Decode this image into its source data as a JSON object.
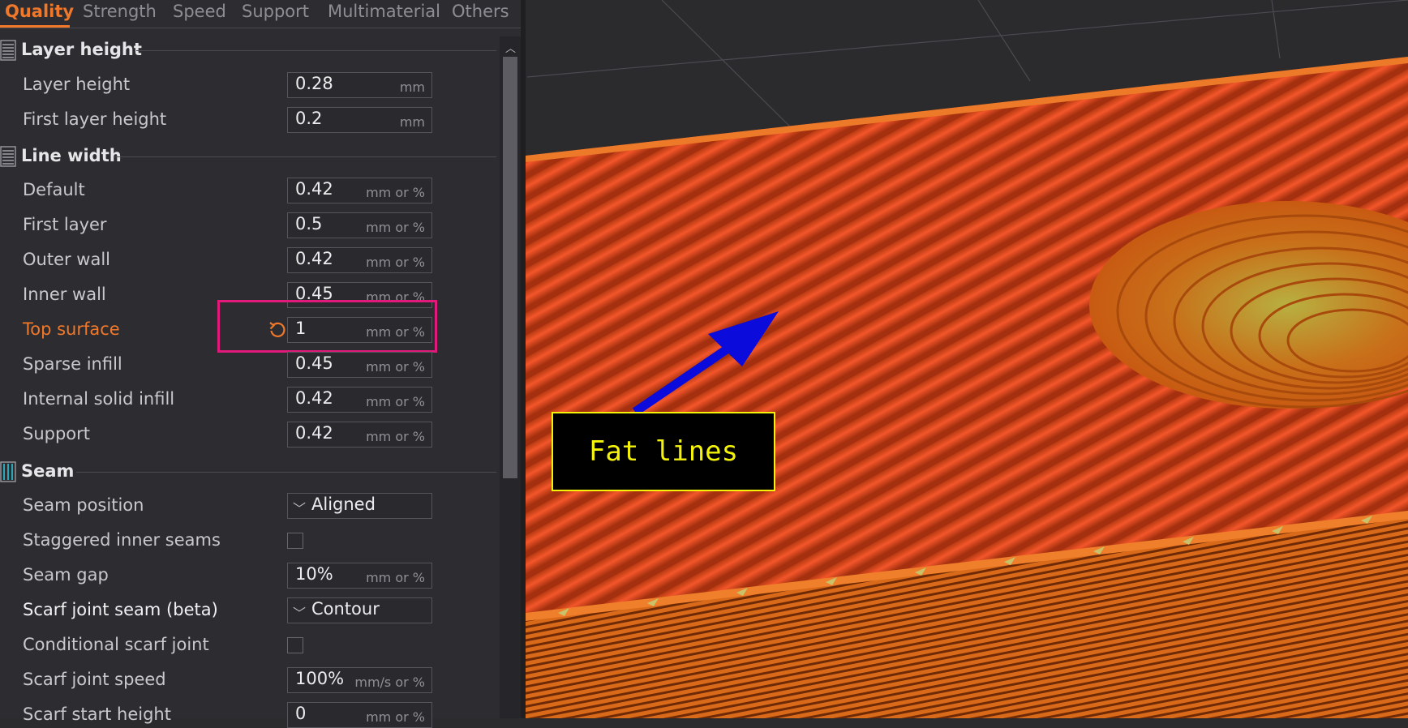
{
  "tabs": [
    "Quality",
    "Strength",
    "Speed",
    "Support",
    "Multimaterial",
    "Others"
  ],
  "active_tab": "Quality",
  "accent_color": "#f0782a",
  "highlight_color": "#e0197a",
  "sections": {
    "layer_height": {
      "title": "Layer height",
      "rows": [
        {
          "label": "Layer height",
          "value": "0.28",
          "unit": "mm"
        },
        {
          "label": "First layer height",
          "value": "0.2",
          "unit": "mm"
        }
      ]
    },
    "line_width": {
      "title": "Line width",
      "rows": [
        {
          "label": "Default",
          "value": "0.42",
          "unit": "mm or %"
        },
        {
          "label": "First layer",
          "value": "0.5",
          "unit": "mm or %"
        },
        {
          "label": "Outer wall",
          "value": "0.42",
          "unit": "mm or %"
        },
        {
          "label": "Inner wall",
          "value": "0.45",
          "unit": "mm or %"
        },
        {
          "label": "Top surface",
          "value": "1",
          "unit": "mm or %",
          "modified": true
        },
        {
          "label": "Sparse infill",
          "value": "0.45",
          "unit": "mm or %"
        },
        {
          "label": "Internal solid infill",
          "value": "0.42",
          "unit": "mm or %"
        },
        {
          "label": "Support",
          "value": "0.42",
          "unit": "mm or %"
        }
      ]
    },
    "seam": {
      "title": "Seam",
      "rows": [
        {
          "label": "Seam position",
          "type": "dropdown",
          "value": "Aligned"
        },
        {
          "label": "Staggered inner seams",
          "type": "checkbox",
          "checked": false
        },
        {
          "label": "Seam gap",
          "value": "10%",
          "unit": "mm or %"
        },
        {
          "label": "Scarf joint seam (beta)",
          "type": "dropdown",
          "value": "Contour"
        },
        {
          "label": "Conditional scarf joint",
          "type": "checkbox",
          "checked": false
        },
        {
          "label": "Scarf joint speed",
          "value": "100%",
          "unit": "mm/s or %"
        },
        {
          "label": "Scarf start height",
          "value": "0",
          "unit": "mm or %"
        }
      ]
    }
  },
  "icons": {
    "section": "list-lines-icon",
    "seam": "seam-bars-icon",
    "reset": "undo-arrow-icon",
    "dropdown": "chevron-down-icon",
    "scroll": "chevron-up-icon"
  },
  "preview": {
    "annotation": "Fat lines",
    "filament_color": "#e64a19",
    "arrow_color": "#0b0bdc"
  }
}
